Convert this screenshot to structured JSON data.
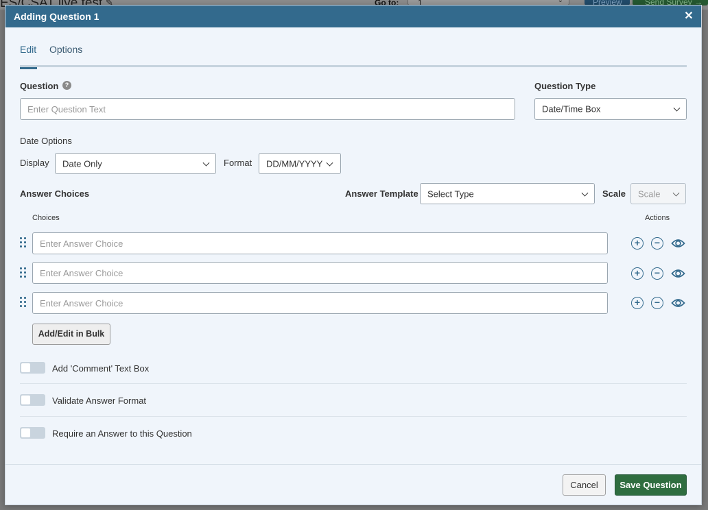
{
  "background": {
    "page_title": "ES/CSAT live test",
    "goto_label": "Go to:",
    "goto_value": "1",
    "preview_label": "Preview",
    "send_label": "Send Survey →"
  },
  "modal": {
    "title": "Adding Question 1",
    "close_glyph": "✕",
    "tabs": [
      {
        "label": "Edit",
        "active": true
      },
      {
        "label": "Options",
        "active": false
      }
    ],
    "question_label": "Question",
    "question_help_glyph": "?",
    "question_placeholder": "Enter Question Text",
    "question_value": "",
    "question_type_label": "Question Type",
    "question_type_value": "Date/Time Box",
    "date_options_label": "Date Options",
    "display_label": "Display",
    "display_value": "Date Only",
    "format_label": "Format",
    "format_value": "DD/MM/YYYY",
    "answer_choices_label": "Answer Choices",
    "answer_template_label": "Answer Template",
    "answer_template_value": "Select Type",
    "scale_label": "Scale",
    "scale_value": "Scale",
    "choices_header": "Choices",
    "actions_header": "Actions",
    "choices": [
      {
        "placeholder": "Enter Answer Choice",
        "value": ""
      },
      {
        "placeholder": "Enter Answer Choice",
        "value": ""
      },
      {
        "placeholder": "Enter Answer Choice",
        "value": ""
      }
    ],
    "add_glyph": "+",
    "remove_glyph": "−",
    "bulk_button": "Add/Edit in Bulk",
    "toggles": [
      {
        "label": "Add 'Comment' Text Box",
        "on": false
      },
      {
        "label": "Validate Answer Format",
        "on": false
      },
      {
        "label": "Require an Answer to this Question",
        "on": false
      }
    ],
    "cancel_button": "Cancel",
    "save_button": "Save Question"
  },
  "colors": {
    "header": "#336a8d",
    "primary_button": "#2f6d3f",
    "modal_background": "#f0f5fb",
    "icon_accent": "#336a8d"
  },
  "icons": {
    "close": "close-icon",
    "help": "help-icon",
    "drag": "drag-handle-icon",
    "add": "plus-circle-icon",
    "remove": "minus-circle-icon",
    "visibility": "eye-icon",
    "dropdown": "chevron-down-icon"
  }
}
